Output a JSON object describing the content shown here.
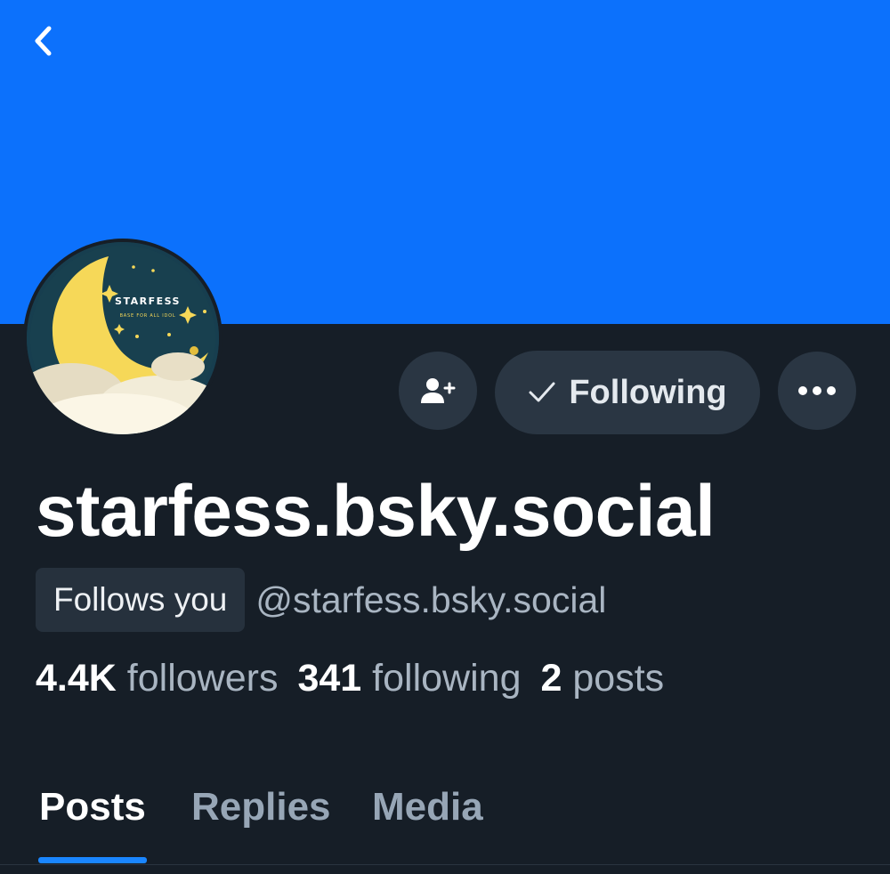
{
  "header": {
    "back_icon": "chevron-left-icon"
  },
  "profile": {
    "avatar_text": {
      "title": "STARFESS",
      "subtitle": "BASE FOR ALL IDOL"
    },
    "display_name": "starfess.bsky.social",
    "follows_you_label": "Follows you",
    "handle": "@starfess.bsky.social"
  },
  "actions": {
    "add_user_icon": "person-plus-icon",
    "following_label": "Following",
    "check_icon": "check-icon",
    "more_icon": "ellipsis-icon"
  },
  "stats": {
    "followers_count": "4.4K",
    "followers_label": "followers",
    "following_count": "341",
    "following_label": "following",
    "posts_count": "2",
    "posts_label": "posts"
  },
  "tabs": [
    {
      "label": "Posts",
      "active": true
    },
    {
      "label": "Replies",
      "active": false
    },
    {
      "label": "Media",
      "active": false
    }
  ],
  "colors": {
    "banner": "#0c71fc",
    "background": "#161e27",
    "button": "#2a3643",
    "accent": "#1a86ff"
  }
}
